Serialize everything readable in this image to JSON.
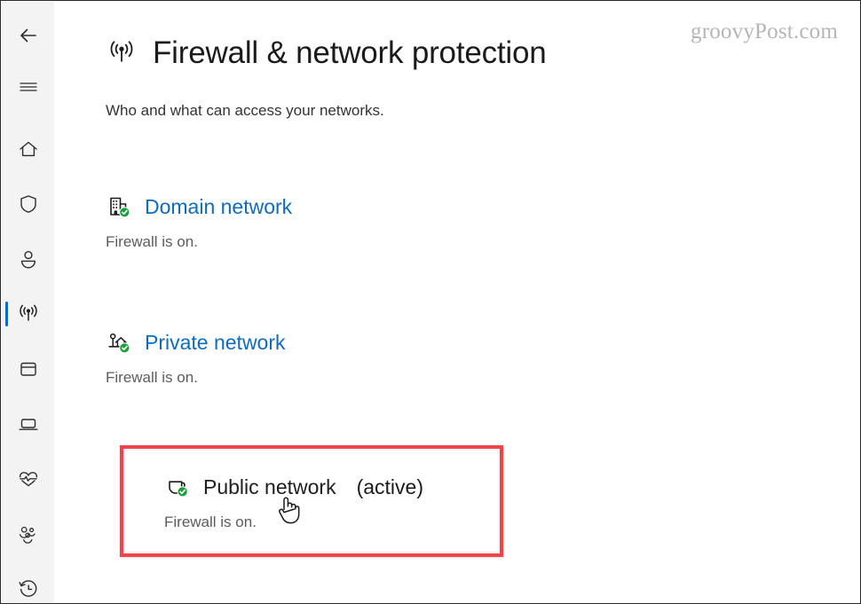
{
  "window": {
    "title": "Firewall & network protection",
    "watermark": "groovyPost.com"
  },
  "sidebar": {
    "items": [
      {
        "name": "back-button",
        "icon": "back-arrow-icon",
        "label": "Back",
        "active": false
      },
      {
        "name": "nav-menu-button",
        "icon": "hamburger-menu-icon",
        "label": "Menu",
        "active": false
      },
      {
        "name": "sidebar-item-home",
        "icon": "home-icon",
        "label": "Home",
        "active": false
      },
      {
        "name": "sidebar-item-virus",
        "icon": "shield-icon",
        "label": "Virus & threat protection",
        "active": false
      },
      {
        "name": "sidebar-item-account",
        "icon": "person-icon",
        "label": "Account protection",
        "active": false
      },
      {
        "name": "sidebar-item-firewall",
        "icon": "wifi-signal-icon",
        "label": "Firewall & network protection",
        "active": true
      },
      {
        "name": "sidebar-item-appbrowser",
        "icon": "app-window-icon",
        "label": "App & browser control",
        "active": false
      },
      {
        "name": "sidebar-item-device",
        "icon": "device-laptop-icon",
        "label": "Device security",
        "active": false
      },
      {
        "name": "sidebar-item-health",
        "icon": "heart-pulse-icon",
        "label": "Device performance & health",
        "active": false
      },
      {
        "name": "sidebar-item-family",
        "icon": "family-group-icon",
        "label": "Family options",
        "active": false
      },
      {
        "name": "sidebar-item-history",
        "icon": "history-clock-icon",
        "label": "Protection history",
        "active": false
      }
    ]
  },
  "header": {
    "icon": "wifi-signal-icon",
    "title": "Firewall & network protection",
    "subtitle": "Who and what can access your networks."
  },
  "profiles": [
    {
      "id": "domain",
      "icon": "building-icon",
      "badge": "green-check-badge",
      "name": "Domain network",
      "active_suffix": "",
      "status": "Firewall is on.",
      "link": true
    },
    {
      "id": "private",
      "icon": "house-icon",
      "badge": "green-check-badge",
      "name": "Private network",
      "active_suffix": "",
      "status": "Firewall is on.",
      "link": true
    },
    {
      "id": "public",
      "icon": "coffee-cup-icon",
      "badge": "green-check-badge",
      "name": "Public network",
      "active_suffix": "(active)",
      "status": "Firewall is on.",
      "link": false
    }
  ],
  "annotation": {
    "highlight_color": "#f2434b",
    "cursor": "hand-pointer-cursor"
  },
  "colors": {
    "link_blue": "#0f6cbd",
    "accent_blue": "#0f6cbd",
    "badge_green": "#1a9e37",
    "sidebar_bg": "#f3f3f3",
    "body_text": "#1b1b1b",
    "muted_text": "#5c5c5c"
  }
}
